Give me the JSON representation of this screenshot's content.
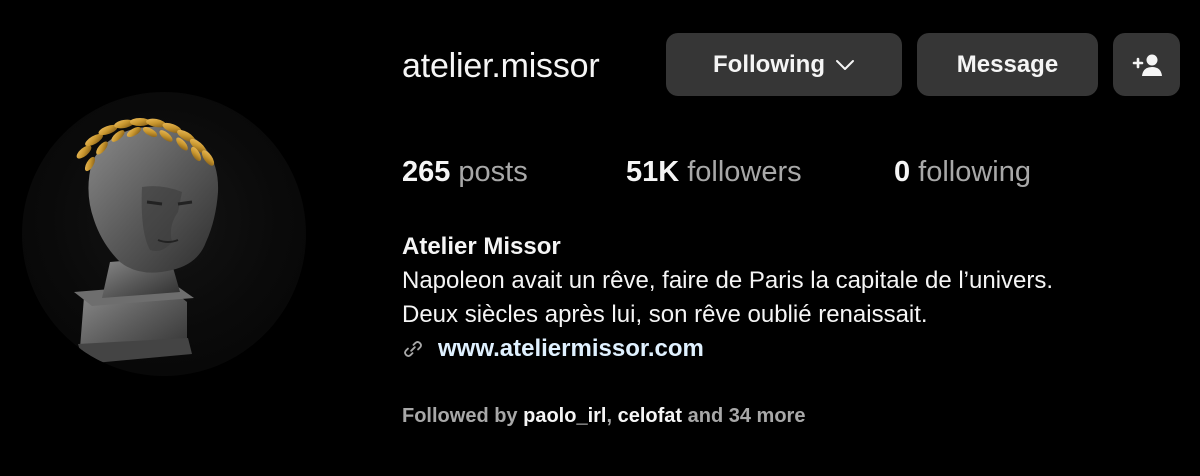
{
  "profile": {
    "username": "atelier.missor",
    "avatar_icon": "laurel-crowned-bust-avatar"
  },
  "actions": {
    "following_label": "Following",
    "message_label": "Message",
    "add_user_icon": "add-user-icon"
  },
  "stats": {
    "posts_count": "265",
    "posts_label": "posts",
    "followers_count": "51K",
    "followers_label": "followers",
    "following_count": "0",
    "following_label": "following"
  },
  "bio": {
    "name": "Atelier Missor",
    "line1": "Napoleon avait un rêve, faire de Paris la capitale de l’univers.",
    "line2": "Deux siècles après lui, son rêve oublié renaissait.",
    "link": "www.ateliermissor.com",
    "link_icon": "link-icon"
  },
  "followed_by": {
    "prefix": "Followed by",
    "user1": "paolo_irl",
    "separator": ",",
    "user2": "celofat",
    "suffix": "and 34 more"
  },
  "colors": {
    "background": "#000000",
    "button": "#363636",
    "text_primary": "#f5f5f5",
    "text_secondary": "#a8a8a8",
    "link": "#e0f1ff",
    "laurel_gold": "#c8962e"
  }
}
